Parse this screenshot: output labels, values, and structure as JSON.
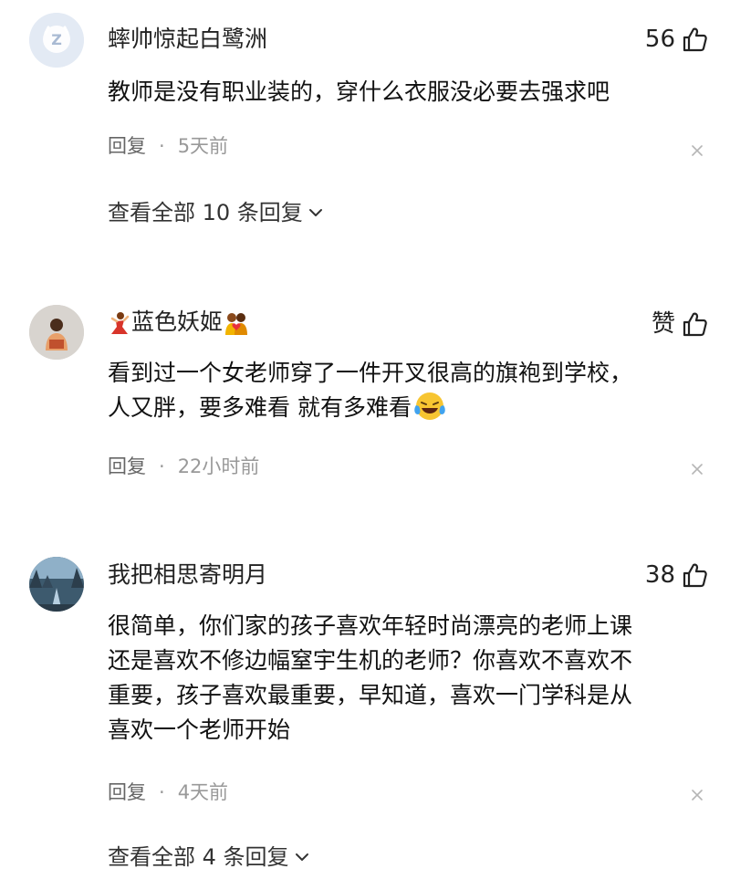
{
  "comments": [
    {
      "username": "蟀帅惊起白鹭洲",
      "like_count": "56",
      "text": "教师是没有职业装的，穿什么衣服没必要去强求吧",
      "reply_label": "回复",
      "separator": "·",
      "time": "5天前",
      "view_replies": "查看全部 10 条回复"
    },
    {
      "username": "蓝色妖姬",
      "like_label": "赞",
      "text": "看到过一个女老师穿了一件开叉很高的旗袍到学校，\n人又胖，要多难看 就有多难看",
      "reply_label": "回复",
      "separator": "·",
      "time": "22小时前"
    },
    {
      "username": "我把相思寄明月",
      "like_count": "38",
      "text": "很简单，你们家的孩子喜欢年轻时尚漂亮的老师上课\n还是喜欢不修边幅窒宇生机的老师？你喜欢不喜欢不\n重要，孩子喜欢最重要，早知道，喜欢一门学科是从\n喜欢一个老师开始",
      "reply_label": "回复",
      "separator": "·",
      "time": "4天前",
      "view_replies": "查看全部 4 条回复"
    }
  ],
  "icons": {
    "thumb": "thumbs-up-outline-icon",
    "close": "close-icon",
    "chevron": "chevron-down-icon"
  },
  "colors": {
    "text": "#1a1a1a",
    "meta": "#666666",
    "muted": "#999999"
  }
}
